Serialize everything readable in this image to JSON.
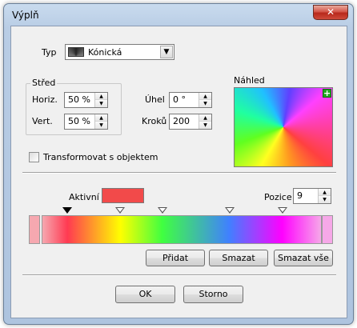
{
  "window": {
    "title": "Výplň",
    "close_symbol": "✕"
  },
  "type_row": {
    "label": "Typ",
    "value": "Kónická"
  },
  "center_group": {
    "label": "Střed",
    "horiz_label": "Horiz.",
    "horiz_value": "50 %",
    "vert_label": "Vert.",
    "vert_value": "50 %"
  },
  "angle": {
    "label": "Úhel",
    "value": "0 °"
  },
  "steps": {
    "label": "Kroků",
    "value": "200"
  },
  "preview": {
    "label": "Náhled",
    "plus_symbol": "+"
  },
  "transform_checkbox": {
    "label": "Transformovat s objektem",
    "checked": false
  },
  "gradient": {
    "active_label": "Aktivní",
    "active_color": "#f24a4a",
    "position_label": "Pozice",
    "position_value": "9",
    "stops": [
      {
        "color": "#ff3a52",
        "position": 9,
        "selected": true
      },
      {
        "color": "#ffff00",
        "position": 28,
        "selected": false
      },
      {
        "color": "#40ff40",
        "position": 43,
        "selected": false
      },
      {
        "color": "#4080ff",
        "position": 67,
        "selected": false
      },
      {
        "color": "#ff00ff",
        "position": 86,
        "selected": false
      }
    ],
    "start_color": "#f6a8b0",
    "end_color": "#f6a8e8"
  },
  "buttons": {
    "add": "Přidat",
    "delete": "Smazat",
    "delete_all": "Smazat vše",
    "ok": "OK",
    "cancel": "Storno"
  }
}
